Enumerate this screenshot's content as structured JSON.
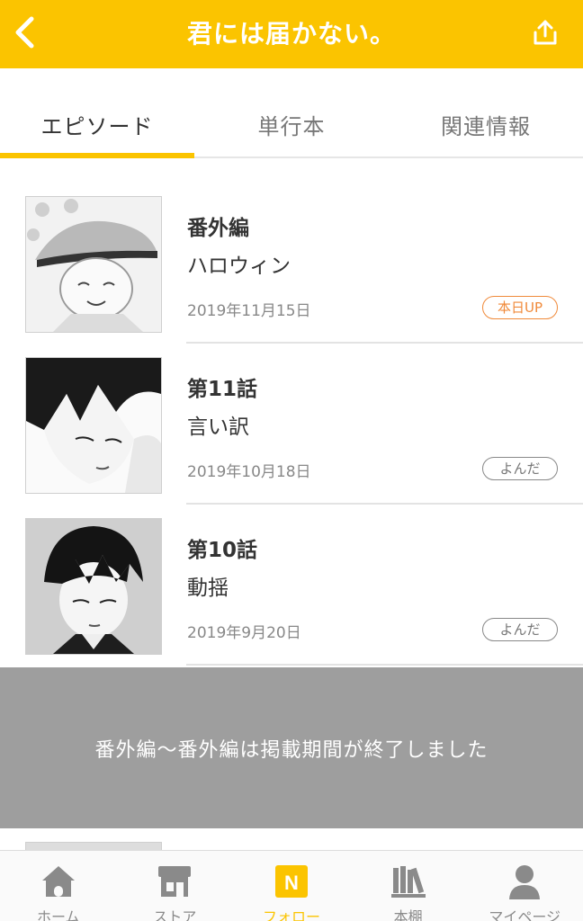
{
  "header": {
    "title": "君には届かない。",
    "back_icon": "chevron-left-icon",
    "share_icon": "share-icon"
  },
  "tabs": [
    {
      "label": "エピソード",
      "active": true
    },
    {
      "label": "単行本",
      "active": false
    },
    {
      "label": "関連情報",
      "active": false
    }
  ],
  "episodes": [
    {
      "number": "番外編",
      "title": "ハロウィン",
      "date": "2019年11月15日",
      "badge": "本日UP",
      "badge_style": "up"
    },
    {
      "number": "第11話",
      "title": "言い訳",
      "date": "2019年10月18日",
      "badge": "よんだ",
      "badge_style": "read"
    },
    {
      "number": "第10話",
      "title": "動揺",
      "date": "2019年9月20日",
      "badge": "よんだ",
      "badge_style": "read"
    }
  ],
  "expired_notice": "番外編〜番外編は掲載期間が終了しました",
  "bottom_nav": [
    {
      "label": "ホーム",
      "icon": "home-icon",
      "active": false
    },
    {
      "label": "ストア",
      "icon": "store-icon",
      "active": false
    },
    {
      "label": "フォロー",
      "icon": "follow-n-icon",
      "active": true
    },
    {
      "label": "本棚",
      "icon": "bookshelf-icon",
      "active": false
    },
    {
      "label": "マイページ",
      "icon": "person-icon",
      "active": false
    }
  ],
  "colors": {
    "brand_yellow": "#fbc400",
    "up_badge_orange": "#f08a3a",
    "overlay_gray": "#9e9e9e"
  }
}
